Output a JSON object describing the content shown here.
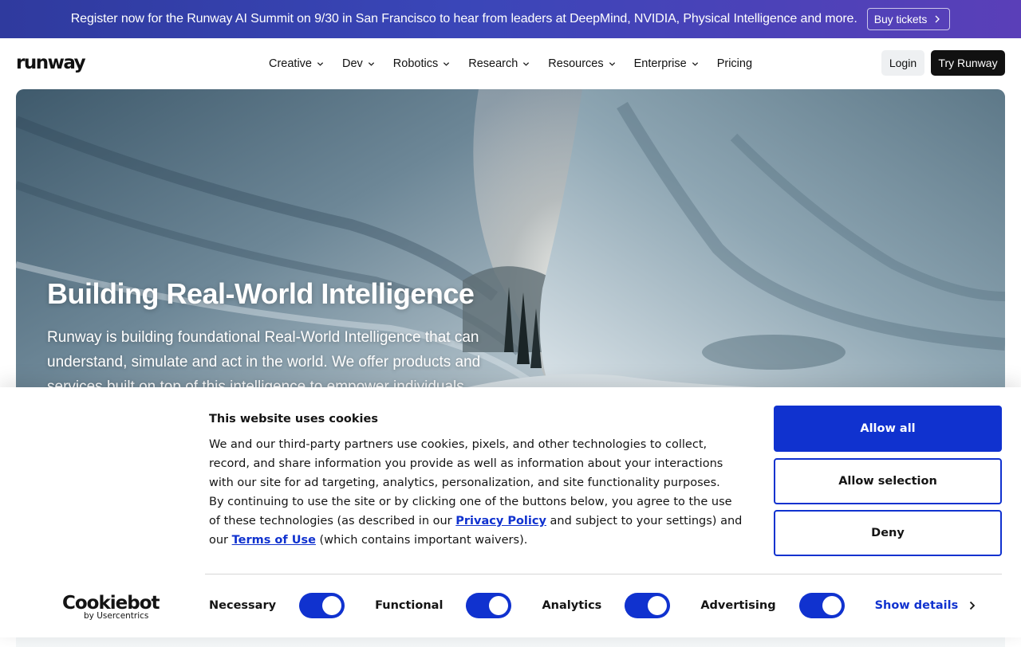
{
  "banner": {
    "text": "Register now for the Runway AI Summit on 9/30 in San Francisco to hear from leaders at DeepMind, NVIDIA, Physical Intelligence and more.",
    "button_label": "Buy tickets"
  },
  "header": {
    "logo": "runway",
    "nav": [
      {
        "label": "Creative"
      },
      {
        "label": "Dev"
      },
      {
        "label": "Robotics"
      },
      {
        "label": "Research"
      },
      {
        "label": "Resources"
      },
      {
        "label": "Enterprise"
      },
      {
        "label": "Pricing"
      }
    ],
    "login_label": "Login",
    "try_label": "Try Runway"
  },
  "hero": {
    "title": "Building Real-World Intelligence",
    "description": "Runway is building foundational Real-World Intelligence that can understand, simulate and act in the world. We offer products and services built on top of this intelligence to empower individuals"
  },
  "cookie": {
    "title": "This website uses cookies",
    "paragraph1": "We and our third-party partners use cookies, pixels, and other technologies to collect, record, and share information you provide as well as information about your interactions with our site for ad targeting, analytics, personalization, and site functionality purposes.",
    "paragraph2_before": "By continuing to use the site or by clicking one of the buttons below, you agree to the use of these technologies (as described in our ",
    "privacy_link": "Privacy Policy",
    "paragraph2_middle": " and subject to your settings) and our ",
    "terms_link": "Terms of Use",
    "paragraph2_after": " (which contains important waivers).",
    "allow_all": "Allow all",
    "allow_selection": "Allow selection",
    "deny": "Deny",
    "brand": "Cookiebot",
    "brand_sub": "by Usercentrics",
    "toggles": [
      {
        "label": "Necessary",
        "on": true
      },
      {
        "label": "Functional",
        "on": true
      },
      {
        "label": "Analytics",
        "on": true
      },
      {
        "label": "Advertising",
        "on": true
      }
    ],
    "show_details": "Show details"
  },
  "colors": {
    "accent": "#1032cf",
    "banner_start": "#2f3a9e",
    "banner_end": "#5a3fb8"
  }
}
